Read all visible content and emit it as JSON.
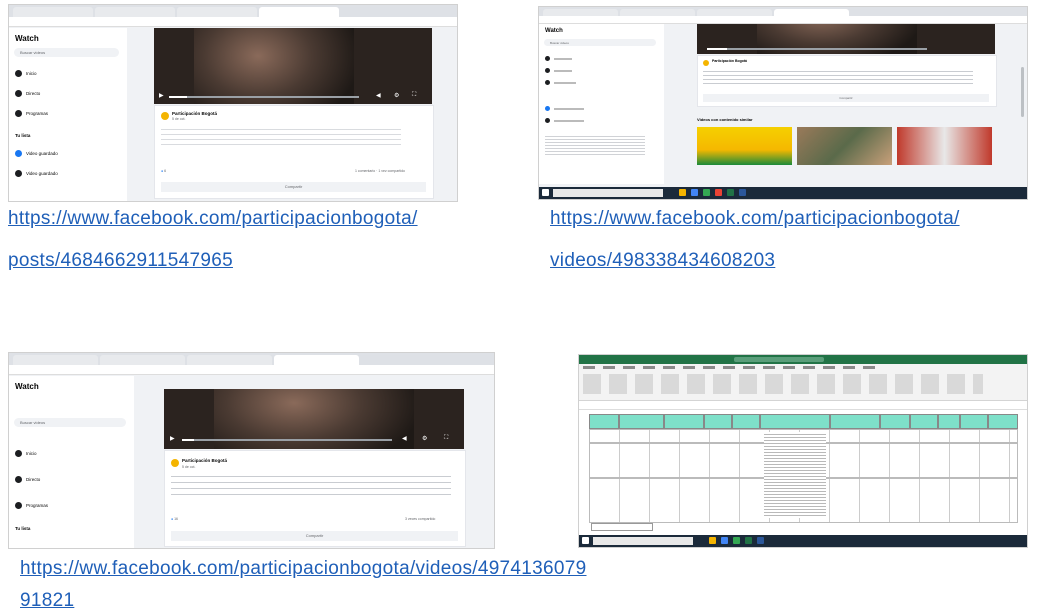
{
  "links": {
    "link1_line1": "https://www.facebook.com/participacionbogota/",
    "link1_line2": "posts/4684662911547965",
    "link2_line1": "https://www.facebook.com/participacionbogota/",
    "link2_line2": "videos/498338434608203",
    "link3_line1": "https://ww.facebook.com/participacionbogota/videos/4974136079",
    "link3_line2": "91821"
  },
  "shot1": {
    "sidebar_title": "Watch",
    "search_placeholder": "Buscar videos",
    "items": [
      "Inicio",
      "Directo",
      "Programas"
    ],
    "section": "Tu lista",
    "list_items": [
      "Video guardado",
      "Video guardado"
    ],
    "author": "Participación Bogotá",
    "time": "5 de oct.",
    "share": "Compartir",
    "comments": "1 comentario · 1 vez compartido",
    "reactions": "6"
  },
  "shot2": {
    "sidebar_title": "Watch",
    "search_placeholder": "Buscar videos",
    "author": "Participación Bogotá",
    "related_title": "Videos con contenido similar",
    "share": "Compartir"
  },
  "shot3": {
    "sidebar_title": "Watch",
    "search_placeholder": "Buscar videos",
    "items": [
      "Inicio",
      "Directo",
      "Programas"
    ],
    "section": "Tu lista",
    "author": "Participación Bogotá",
    "time": "5 de oct.",
    "share": "Compartir",
    "reactions": "16",
    "shares": "3 veces compartido"
  },
  "colors": {
    "link": "#1f5fb8",
    "facebook_blue": "#1877f2",
    "excel_green": "#217346",
    "excel_header": "#7ee0c9"
  }
}
